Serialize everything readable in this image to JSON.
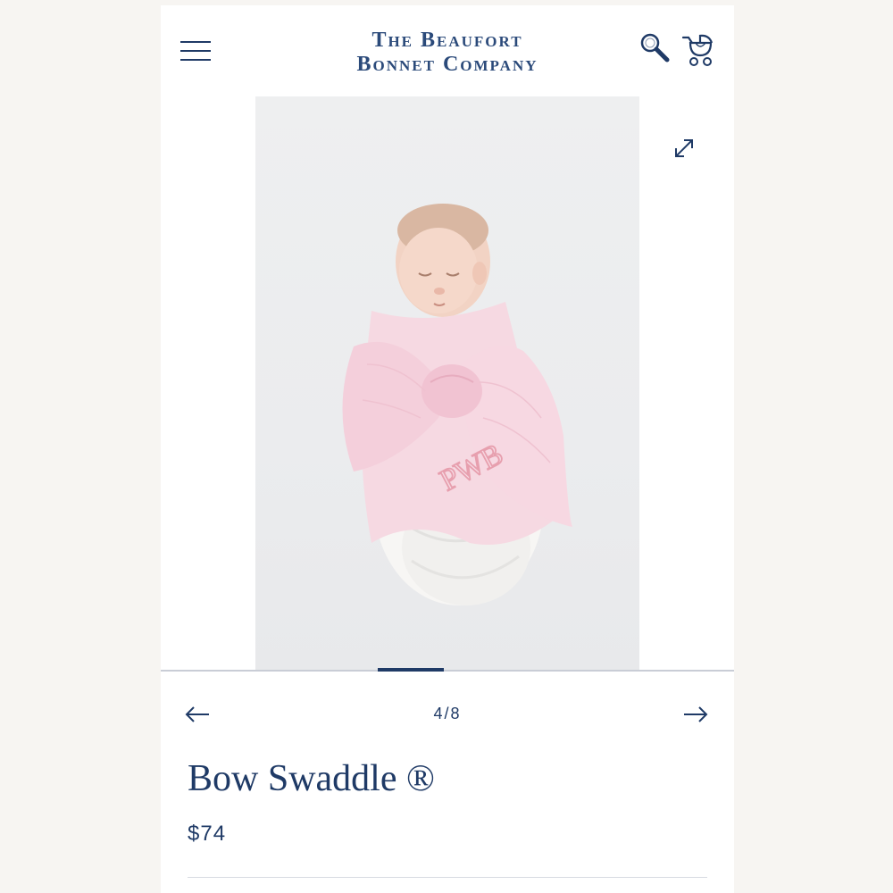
{
  "header": {
    "brand_line1": "The Beaufort",
    "brand_line2": "Bonnet Company",
    "menu_icon": "hamburger-icon",
    "search_icon": "magnifier-icon",
    "cart_icon": "stroller-cart-icon"
  },
  "gallery": {
    "image_subject": "sleeping baby in pink bow swaddle",
    "monogram": "PWB",
    "expand_icon": "expand-icon",
    "current": 4,
    "total": 8,
    "counter_text": "4/8",
    "prev_icon": "arrow-left-icon",
    "next_icon": "arrow-right-icon"
  },
  "product": {
    "title": "Bow Swaddle ®",
    "price": "$74"
  },
  "colors": {
    "navy": "#1f3a66",
    "brand": "#2b4a7a",
    "swaddle_pink": "#f4d6df",
    "monogram_pink": "#e79fae"
  }
}
